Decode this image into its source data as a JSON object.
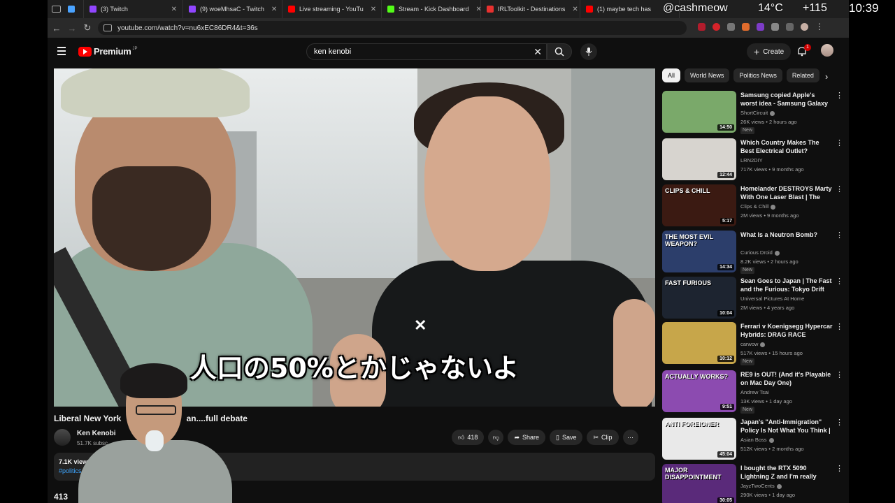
{
  "browser": {
    "tabs": [
      {
        "label": "",
        "color": "#4aa3ff"
      },
      {
        "label": "(3) Twitch",
        "color": "#9146ff"
      },
      {
        "label": "(9) woeMhsaC - Twitch",
        "color": "#9146ff"
      },
      {
        "label": "Live streaming - YouTu",
        "color": "#ff0000"
      },
      {
        "label": "Stream - Kick Dashboard",
        "color": "#53fc18"
      },
      {
        "label": "IRLToolkit - Destinations",
        "color": "#e8312f"
      },
      {
        "label": "(1) maybe tech has",
        "color": "#ff0000"
      }
    ],
    "url": "youtube.com/watch?v=nu6xEC86DR4&t=36s"
  },
  "system_overlay": {
    "handle": "@cashmeow",
    "temperature": "14°C",
    "counter": "+115",
    "clock": "10:39"
  },
  "youtube": {
    "logo_text": "Premium",
    "logo_region": "JP",
    "search_query": "ken kenobi",
    "create_label": "Create",
    "notif_count": "1"
  },
  "video": {
    "subtitle": "人口の50%とかじゃないよ",
    "title": "Liberal New York",
    "title_tail": "an....full debate",
    "channel": "Ken Kenobi",
    "subscribers": "51.7K subsc",
    "likes": "418",
    "share_label": "Share",
    "save_label": "Save",
    "clip_label": "Clip",
    "views": "7.1K views",
    "hashtag": "#politics",
    "comments": "413"
  },
  "chips": [
    "All",
    "World News",
    "Politics News",
    "Related"
  ],
  "recommendations": [
    {
      "title": "Samsung copied Apple's worst idea - Samsung Galaxy XR",
      "channel": "ShortCircuit",
      "verified": true,
      "meta": "26K views • 2 hours ago",
      "badge": "New",
      "duration": "14:50",
      "thumb": "#7aa96a",
      "thumb_text": ""
    },
    {
      "title": "Which Country Makes The Best Electrical Outlet?",
      "channel": "LRN2DIY",
      "verified": false,
      "meta": "717K views • 9 months ago",
      "badge": "",
      "duration": "12:44",
      "thumb": "#d7d4cf",
      "thumb_text": ""
    },
    {
      "title": "Homelander DESTROYS Marty With One Laser Blast | The Boy...",
      "channel": "Clips & Chill",
      "verified": true,
      "meta": "2M views • 9 months ago",
      "badge": "",
      "duration": "5:17",
      "thumb": "#3b1a12",
      "thumb_text": "CLIPS & CHILL"
    },
    {
      "title": "What Is a Neutron Bomb?",
      "channel": "Curious Droid",
      "verified": true,
      "meta": "8.2K views • 2 hours ago",
      "badge": "New",
      "duration": "14:34",
      "thumb": "#2c3e6b",
      "thumb_text": "THE MOST EVIL WEAPON?"
    },
    {
      "title": "Sean Goes to Japan | The Fast and the Furious: Tokyo Drift",
      "channel": "Universal Pictures At Home",
      "verified": false,
      "meta": "2M views • 4 years ago",
      "badge": "",
      "duration": "10:04",
      "thumb": "#1d2430",
      "thumb_text": "FAST FURIOUS"
    },
    {
      "title": "Ferrari v Koenigsegg Hypercar Hybrids: DRAG RACE",
      "channel": "carwow",
      "verified": true,
      "meta": "517K views • 15 hours ago",
      "badge": "New",
      "duration": "10:12",
      "thumb": "#c7a64a",
      "thumb_text": ""
    },
    {
      "title": "RE9 is OUT! (And it's Playable on Mac Day One)",
      "channel": "Andrew Tsai",
      "verified": false,
      "meta": "13K views • 1 day ago",
      "badge": "New",
      "duration": "9:51",
      "thumb": "#8c4bb0",
      "thumb_text": "ACTUALLY WORKS?"
    },
    {
      "title": "Japan's \"Anti-Immigration\" Policy Is Not What You Think | ...",
      "channel": "Asian Boss",
      "verified": true,
      "meta": "512K views • 2 months ago",
      "badge": "",
      "duration": "45:04",
      "thumb": "#e9e9e9",
      "thumb_text": "ANTI FOREIGNER"
    },
    {
      "title": "I bought the RTX 5090 Lightning Z and I'm really disappointed...",
      "channel": "JayzTwoCents",
      "verified": true,
      "meta": "290K views • 1 day ago",
      "badge": "",
      "duration": "30:05",
      "thumb": "#5a2a7a",
      "thumb_text": "MAJOR DISAPPOINTMENT"
    }
  ]
}
